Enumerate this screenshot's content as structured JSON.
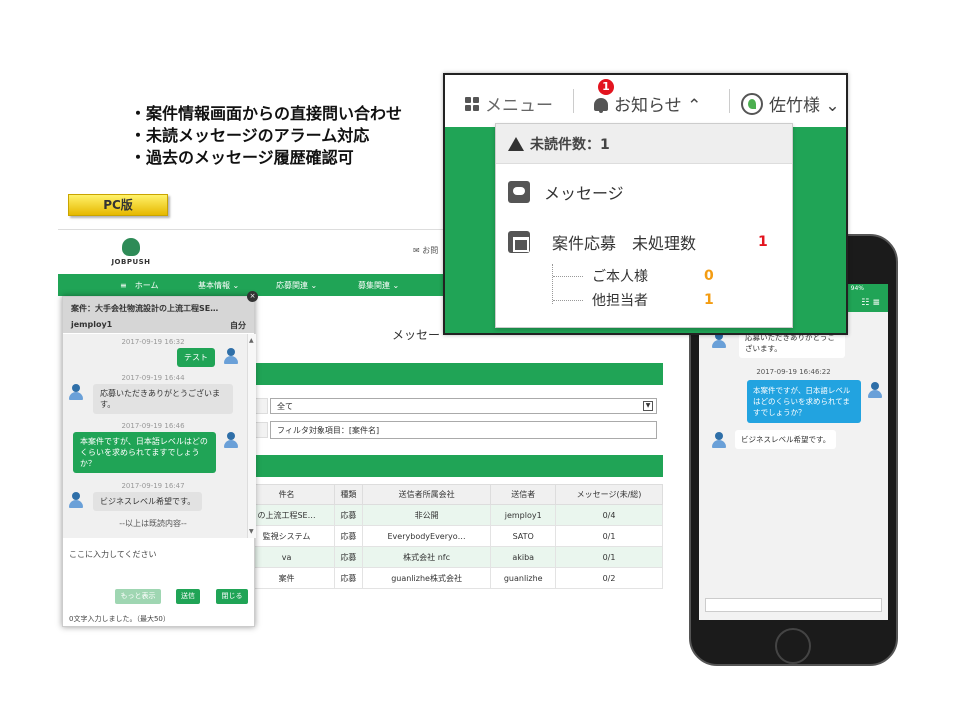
{
  "bullets": [
    "・案件情報画面からの直接問い合わせ",
    "・未読メッセージのアラーム対応",
    "・過去のメッセージ履歴確認可"
  ],
  "pc_badge": "PC版",
  "pc": {
    "logo_text": "JOBPUSH",
    "contact": "✉ お問",
    "nav": [
      "≡　ホーム",
      "基本情報 ⌄",
      "応募関連 ⌄",
      "募集関連 ⌄"
    ],
    "page_title": "メッセー",
    "select_value": "全て",
    "filter_value": "フィルタ対象項目：[案件名]",
    "table": {
      "headers": [
        "件名",
        "種類",
        "送信者所属会社",
        "送信者",
        "メッセージ(未/総)"
      ],
      "rows": [
        [
          "の上流工程SE…",
          "応募",
          "非公開",
          "jemploy1",
          "0/4"
        ],
        [
          "監視システム",
          "応募",
          "EverybodyEveryo…",
          "SATO",
          "0/1"
        ],
        [
          "va",
          "応募",
          "株式会社 nfc",
          "akiba",
          "0/1"
        ],
        [
          "案件",
          "応募",
          "guanlizhe株式会社",
          "guanlizhe",
          "0/2"
        ]
      ]
    }
  },
  "chat": {
    "close": "×",
    "title": "案件：大手会社物流設計の上流工程SE…",
    "user": "jemploy1",
    "self": "自分",
    "messages": [
      {
        "ts": "2017-09-19 16:32",
        "text": "テスト"
      },
      {
        "ts": "2017-09-19 16:44",
        "text": "応募いただきありがとうございます。"
      },
      {
        "ts": "2017-09-19 16:46",
        "text": "本案件ですが、日本語レベルはどのくらいを求められてますでしょうか？"
      },
      {
        "ts": "2017-09-19 16:47",
        "text": "ビジネスレベル希望です。"
      }
    ],
    "end_note": "--以上は既読内容--",
    "input_placeholder": "ここに入力してください",
    "buttons": {
      "more": "もっと表示",
      "send": "送信",
      "close": "閉じる"
    },
    "count": "0文字入力しました。（最大50）"
  },
  "phone": {
    "status": "94%",
    "header_icons": "☷ ≡",
    "top_partial": "応募いただきありがとうございます。",
    "ts": "2017-09-19 16:46:22",
    "question": "本案件ですが、日本語レベルはどのくらいを求められてますでしょうか？",
    "answer": "ビジネスレベル希望です。"
  },
  "notif": {
    "menu": "メニュー",
    "badge": "1",
    "notice": "お知らせ ⌃",
    "user": "佐竹様 ⌄",
    "unread": "未読件数：1",
    "message": "メッセージ",
    "applications": "案件応募　未処理数",
    "applications_count": "1",
    "self_label": "ご本人様",
    "self_count": "0",
    "other_label": "他担当者",
    "other_count": "1",
    "colors": {
      "green": "#20a456",
      "red": "#e3141f",
      "orange": "#f39c12"
    }
  }
}
